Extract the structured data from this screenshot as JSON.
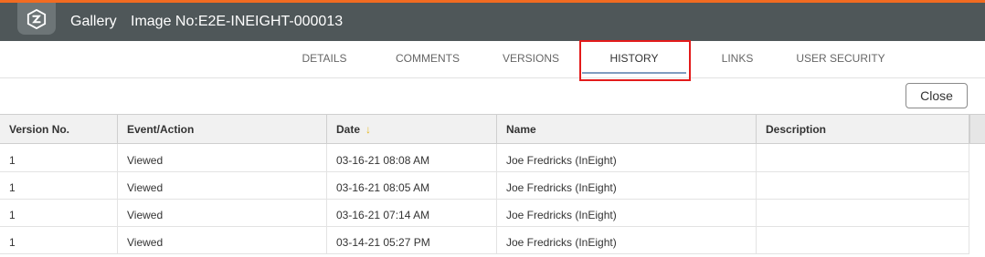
{
  "header": {
    "app_name": "Gallery",
    "image_title": "Image No:E2E-INEIGHT-000013",
    "accent_color": "#f26b21",
    "bar_color": "#4f5759"
  },
  "tabs": [
    {
      "label": "DETAILS",
      "active": false
    },
    {
      "label": "COMMENTS",
      "active": false
    },
    {
      "label": "VERSIONS",
      "active": false
    },
    {
      "label": "HISTORY",
      "active": true
    },
    {
      "label": "LINKS",
      "active": false
    },
    {
      "label": "USER SECURITY",
      "active": false
    }
  ],
  "actions": {
    "close_label": "Close"
  },
  "grid": {
    "columns": [
      "Version No.",
      "Event/Action",
      "Date",
      "Name",
      "Description"
    ],
    "sort_icon": "sort-descending-icon",
    "rows": [
      {
        "version": "1",
        "event": "Viewed",
        "date": "03-16-21 08:08 AM",
        "name": "Joe Fredricks (InEight)",
        "description": ""
      },
      {
        "version": "1",
        "event": "Viewed",
        "date": "03-16-21 08:05 AM",
        "name": "Joe Fredricks (InEight)",
        "description": ""
      },
      {
        "version": "1",
        "event": "Viewed",
        "date": "03-16-21 07:14 AM",
        "name": "Joe Fredricks (InEight)",
        "description": ""
      },
      {
        "version": "1",
        "event": "Viewed",
        "date": "03-14-21 05:27 PM",
        "name": "Joe Fredricks (InEight)",
        "description": ""
      }
    ]
  }
}
